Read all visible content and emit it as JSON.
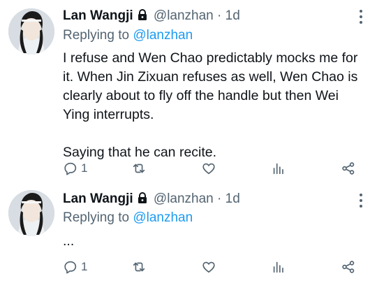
{
  "tweets": [
    {
      "author_name": "Lan Wangji",
      "handle": "@lanzhan",
      "separator": "·",
      "time": "1d",
      "replying_prefix": "Replying to",
      "replying_to": "@lanzhan",
      "text_lines": [
        "I refuse and Wen Chao predictably mocks me for it. When Jin Zixuan refuses as well, Wen Chao is clearly about to fly off the handle but then Wei Ying interrupts.",
        "Saying that he can recite."
      ],
      "reply_count": "1",
      "icons": [
        "reply-icon",
        "retweet-icon",
        "like-icon",
        "analytics-icon",
        "share-icon"
      ]
    },
    {
      "author_name": "Lan Wangji",
      "handle": "@lanzhan",
      "separator": "·",
      "time": "1d",
      "replying_prefix": "Replying to",
      "replying_to": "@lanzhan",
      "text_lines": [
        "..."
      ],
      "reply_count": "1",
      "icons": [
        "reply-icon",
        "retweet-icon",
        "like-icon",
        "analytics-icon",
        "share-icon"
      ]
    }
  ],
  "colors": {
    "accent": "#1d9bf0",
    "secondary_text": "#536471",
    "primary_text": "#0f1419"
  }
}
